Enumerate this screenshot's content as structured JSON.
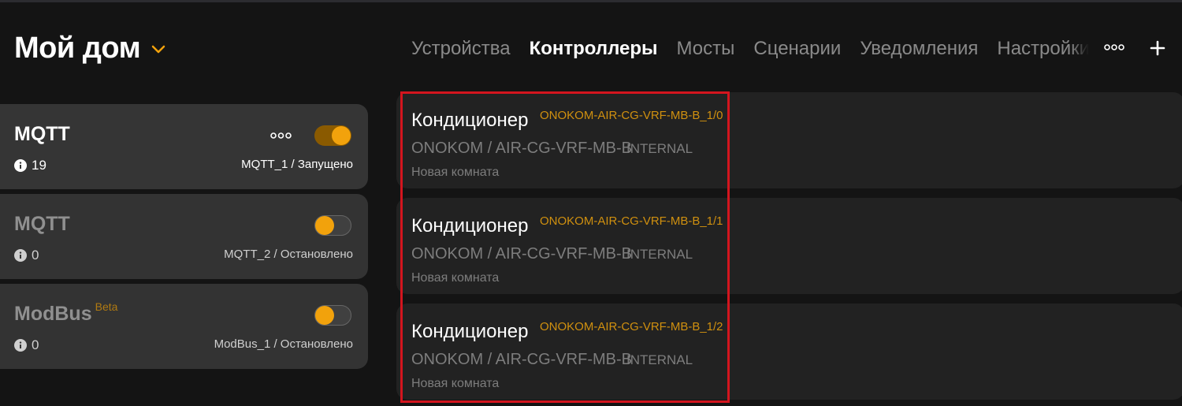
{
  "header": {
    "home_title": "Мой дом",
    "tabs": [
      {
        "label": "Устройства",
        "active": false
      },
      {
        "label": "Контроллеры",
        "active": true
      },
      {
        "label": "Мосты",
        "active": false
      },
      {
        "label": "Сценарии",
        "active": false
      },
      {
        "label": "Уведомления",
        "active": false
      },
      {
        "label": "Настройки",
        "active": false
      }
    ],
    "more_icon": "more-horizontal-icon",
    "add_icon": "plus-icon"
  },
  "controllers": [
    {
      "name": "MQTT",
      "count": "19",
      "status": "MQTT_1 / Запущено",
      "enabled": true
    },
    {
      "name": "MQTT",
      "count": "0",
      "status": "MQTT_2 / Остановлено",
      "enabled": false
    },
    {
      "name": "ModBus",
      "badge": "Beta",
      "count": "0",
      "status": "ModBus_1 / Остановлено",
      "enabled": false
    }
  ],
  "devices": [
    {
      "name": "Кондиционер",
      "code": "ONOKOM-AIR-CG-VRF-MB-B_1/0",
      "model": "ONOKOM / AIR-CG-VRF-MB-B",
      "type": "INTERNAL",
      "room": "Новая комната"
    },
    {
      "name": "Кондиционер",
      "code": "ONOKOM-AIR-CG-VRF-MB-B_1/1",
      "model": "ONOKOM / AIR-CG-VRF-MB-B",
      "type": "INTERNAL",
      "room": "Новая комната"
    },
    {
      "name": "Кондиционер",
      "code": "ONOKOM-AIR-CG-VRF-MB-B_1/2",
      "model": "ONOKOM / AIR-CG-VRF-MB-B",
      "type": "INTERNAL",
      "room": "Новая комната"
    }
  ],
  "colors": {
    "accent": "#f2a20c",
    "highlight": "#d3151e",
    "background": "#141414"
  }
}
